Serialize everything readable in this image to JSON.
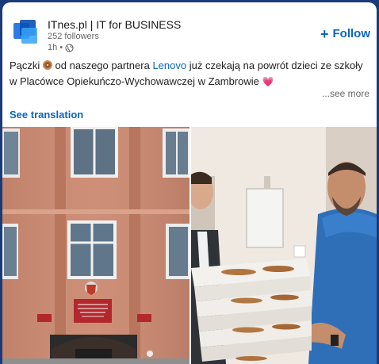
{
  "post": {
    "company_name": "ITnes.pl | IT for BUSINESS",
    "followers": "252 followers",
    "time": "1h",
    "separator": "•",
    "follow_label": "Follow",
    "follow_icon": "plus-icon",
    "text_part1": "Pączki",
    "text_part2": "od naszego partnera",
    "brand": "Lenovo",
    "text_part3": "już czekają na powrót dzieci ze szkoły w Placówce Opiekuńczo-Wychowawczej w Zambrowie",
    "see_more_label": "...see more",
    "see_translation_label": "See translation"
  },
  "colors": {
    "accent": "#0a66c2",
    "background_frame": "#1b3a78",
    "card": "#ffffff"
  },
  "icons": [
    "company-logo-icon",
    "globe-icon",
    "plus-icon",
    "donut-icon",
    "heart-icon"
  ],
  "images": {
    "left_photo": "building-facade-photo",
    "right_photo": "men-with-donut-boxes-photo"
  }
}
